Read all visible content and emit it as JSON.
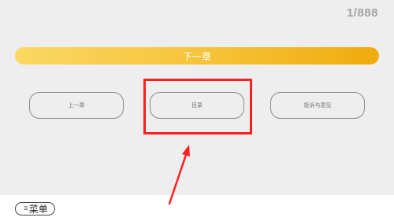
{
  "page_counter": "1/888",
  "next_chapter_label": "下一章",
  "prev_chapter_label": "上一章",
  "toc_label": "目录",
  "feedback_label": "投诉与意见",
  "menu_label": "菜单",
  "menu_icon": "list-icon",
  "colors": {
    "accent_gradient": [
      "#fbd762",
      "#f0ab0c"
    ],
    "highlight": "#ff1f1f"
  }
}
